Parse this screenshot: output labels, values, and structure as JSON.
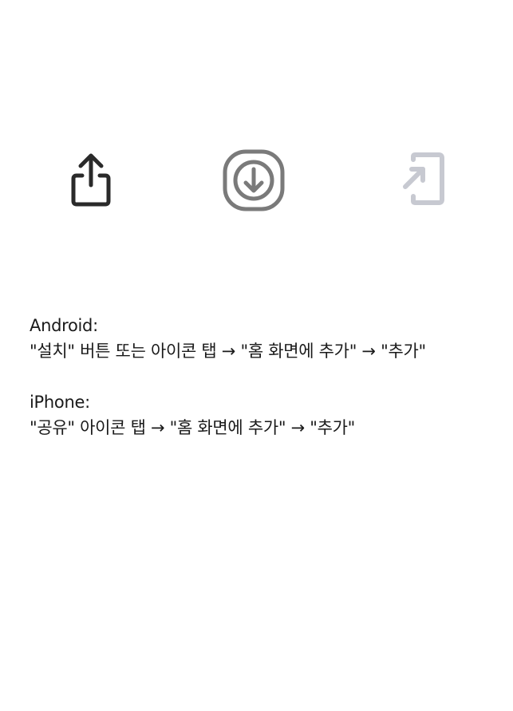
{
  "icons": [
    {
      "name": "share-icon",
      "color": "#2a2a2a"
    },
    {
      "name": "download-circle-icon",
      "color": "#7a7a7a"
    },
    {
      "name": "add-to-home-screen-icon",
      "color": "#c7c9d1"
    }
  ],
  "android": {
    "heading": "Android:",
    "steps": "\"설치\" 버튼 또는 아이콘 탭 → \"홈 화면에 추가\" → \"추가\""
  },
  "iphone": {
    "heading": "iPhone:",
    "steps": "\"공유\" 아이콘 탭 → \"홈 화면에 추가\" → \"추가\""
  }
}
